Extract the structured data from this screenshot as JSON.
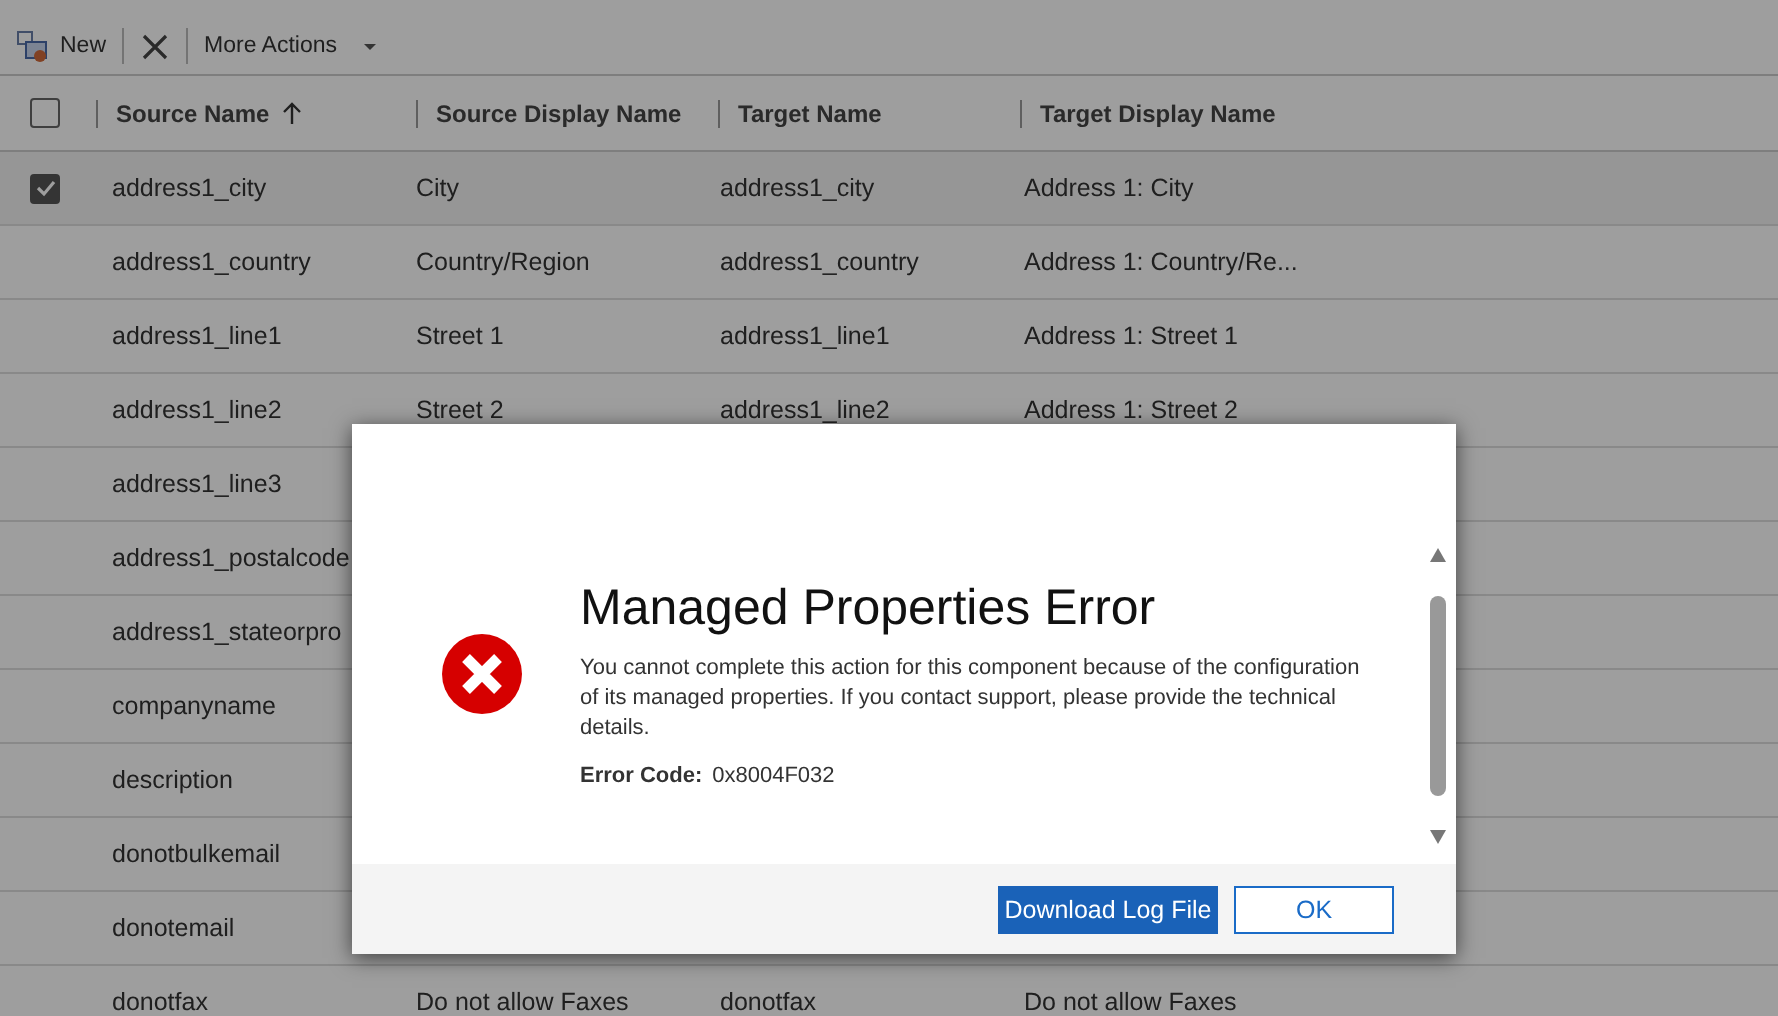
{
  "toolbar": {
    "items": [
      {
        "kind": "new",
        "label": "New"
      },
      {
        "kind": "delete"
      },
      {
        "kind": "menu",
        "label": "More Actions"
      }
    ]
  },
  "grid": {
    "select_all": {
      "checked": false
    },
    "columns": [
      {
        "label": "Source Name",
        "sort_ascending": true
      },
      {
        "label": "Source Display Name",
        "sort_ascending": false
      },
      {
        "label": "Target Name",
        "sort_ascending": false
      },
      {
        "label": "Target Display Name",
        "sort_ascending": false
      }
    ],
    "rows": [
      {
        "selected": true,
        "cells": [
          "address1_city",
          "City",
          "address1_city",
          "Address 1: City"
        ]
      },
      {
        "selected": false,
        "cells": [
          "address1_country",
          "Country/Region",
          "address1_country",
          "Address 1: Country/Re..."
        ]
      },
      {
        "selected": false,
        "cells": [
          "address1_line1",
          "Street 1",
          "address1_line1",
          "Address 1: Street 1"
        ]
      },
      {
        "selected": false,
        "cells": [
          "address1_line2",
          "Street 2",
          "address1_line2",
          "Address 1: Street 2"
        ]
      },
      {
        "selected": false,
        "cells": [
          "address1_line3"
        ]
      },
      {
        "selected": false,
        "cells": [
          "address1_postalcode"
        ]
      },
      {
        "selected": false,
        "cells": [
          "address1_stateorpro"
        ]
      },
      {
        "selected": false,
        "cells": [
          "companyname"
        ]
      },
      {
        "selected": false,
        "cells": [
          "description"
        ]
      },
      {
        "selected": false,
        "cells": [
          "donotbulkemail"
        ]
      },
      {
        "selected": false,
        "cells": [
          "donotemail"
        ]
      },
      {
        "selected": false,
        "cells": [
          "donotfax",
          "Do not allow Faxes",
          "donotfax",
          "Do not allow Faxes"
        ]
      }
    ]
  },
  "dialog": {
    "title": "Managed Properties Error",
    "message": "You cannot complete this action for this component because of the configuration of its managed properties. If you contact support, please provide the technical details.",
    "error_code_label": "Error Code:",
    "error_code": "0x8004F032",
    "buttons": [
      {
        "label": "Download Log File",
        "primary": true
      },
      {
        "label": "OK",
        "primary": false
      }
    ]
  }
}
